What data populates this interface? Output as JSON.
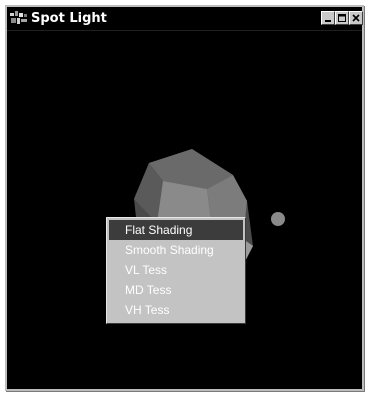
{
  "window": {
    "title": "Spot Light",
    "icon": "app-logo-icon",
    "controls": {
      "minimize_icon": "minimize-icon",
      "maximize_icon": "maximize-icon",
      "close_icon": "close-icon"
    }
  },
  "context_menu": {
    "items": [
      {
        "label": "Flat Shading",
        "selected": true
      },
      {
        "label": "Smooth Shading",
        "selected": false
      },
      {
        "label": "VL Tess",
        "selected": false
      },
      {
        "label": "MD Tess",
        "selected": false
      },
      {
        "label": "VH Tess",
        "selected": false
      }
    ]
  },
  "colors": {
    "background": "#000000",
    "menu_background": "#c3c3c3",
    "menu_highlight": "#3c3c3c",
    "object_light": "#8a8a8a",
    "object_dark": "#4a4a4a"
  }
}
